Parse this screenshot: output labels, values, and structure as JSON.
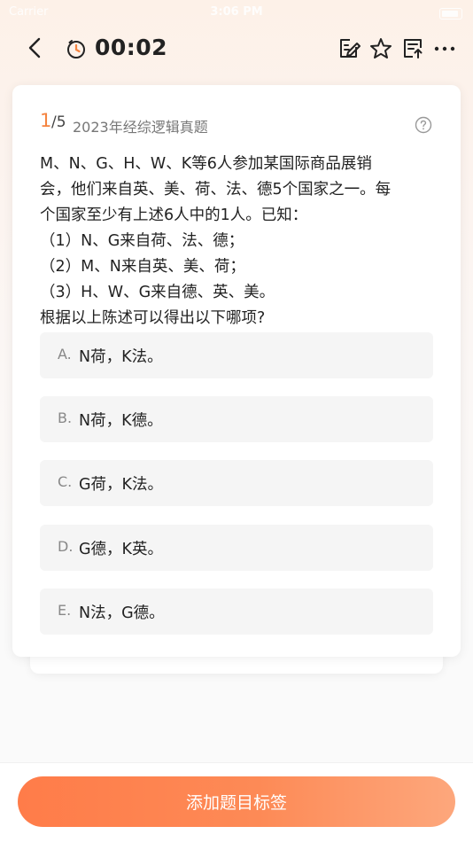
{
  "status_bar": {
    "carrier": "Carrier",
    "time": "3:06 PM"
  },
  "nav": {
    "timer": "00:02",
    "icons": [
      "back-chevron-icon",
      "stopwatch-icon",
      "edit-note-icon",
      "star-icon",
      "answer-sheet-icon",
      "more-dots-icon"
    ]
  },
  "question": {
    "current": "1",
    "total": "/5",
    "category": "2023年经综逻辑真题",
    "stem": [
      "M、N、G、H、W、K等6人参加某国际商品展销",
      "会，他们来自英、美、荷、法、德5个国家之一。每",
      "个国家至少有上述6人中的1人。已知：",
      "（1）N、G来自荷、法、德；",
      "（2）M、N来自英、美、荷；",
      "（3）H、W、G来自德、英、美。",
      "根据以上陈述可以得出以下哪项?"
    ],
    "options": [
      {
        "letter": "A.",
        "text": "N荷，K法。"
      },
      {
        "letter": "B.",
        "text": "N荷，K德。"
      },
      {
        "letter": "C.",
        "text": "G荷，K法。"
      },
      {
        "letter": "D.",
        "text": "G德，K英。"
      },
      {
        "letter": "E.",
        "text": "N法，G德。"
      }
    ]
  },
  "bottom": {
    "button_label": "添加题目标签"
  },
  "colors": {
    "accent": "#f5833f",
    "button_start": "#ff7c49",
    "button_end": "#fda77c",
    "option_bg": "#f5f5f5"
  }
}
